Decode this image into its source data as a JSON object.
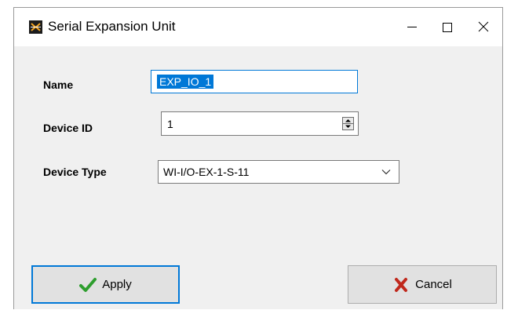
{
  "window": {
    "title": "Serial Expansion Unit",
    "icon": "app-icon",
    "controls": {
      "minimize": "minimize-icon",
      "maximize": "maximize-icon",
      "close": "close-icon"
    }
  },
  "form": {
    "name": {
      "label": "Name",
      "value": "EXP_IO_1",
      "selected": true
    },
    "device_id": {
      "label": "Device ID",
      "value": "1",
      "spinner_icon": "spin-updown-icon"
    },
    "device_type": {
      "label": "Device Type",
      "selected": "WI-I/O-EX-1-S-11",
      "dropdown_icon": "chevron-down-icon"
    }
  },
  "buttons": {
    "apply": {
      "label": "Apply",
      "icon": "checkmark-icon",
      "icon_color": "#2e9e2e"
    },
    "cancel": {
      "label": "Cancel",
      "icon": "cross-icon",
      "icon_color": "#c0281c"
    }
  },
  "colors": {
    "accent": "#0078d7",
    "dialog_bg": "#f0f0f0",
    "button_bg": "#e1e1e1"
  }
}
